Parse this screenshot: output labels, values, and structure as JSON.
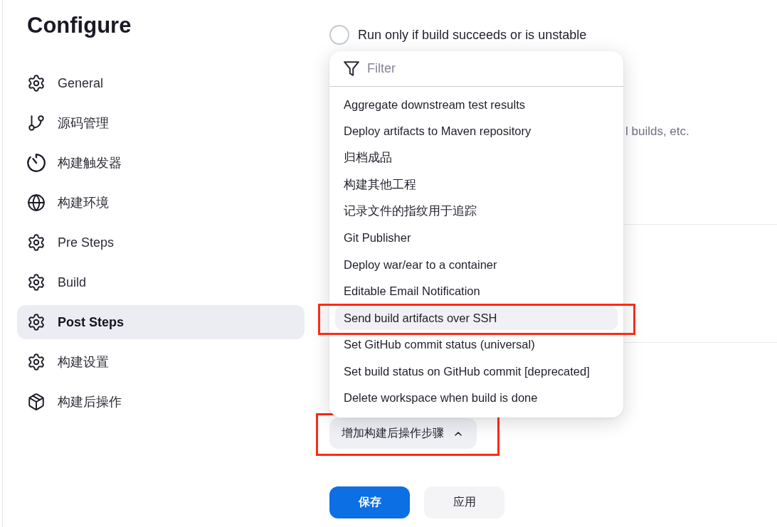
{
  "page": {
    "title": "Configure"
  },
  "sidebar": {
    "items": [
      {
        "label": "General",
        "selected": false
      },
      {
        "label": "源码管理",
        "selected": false
      },
      {
        "label": "构建触发器",
        "selected": false
      },
      {
        "label": "构建环境",
        "selected": false
      },
      {
        "label": "Pre Steps",
        "selected": false
      },
      {
        "label": "Build",
        "selected": false
      },
      {
        "label": "Post Steps",
        "selected": true
      },
      {
        "label": "构建设置",
        "selected": false
      },
      {
        "label": "构建后操作",
        "selected": false
      }
    ]
  },
  "post_build_condition": {
    "label": "Run only if build succeeds or is unstable",
    "checked": false
  },
  "description_fragment": "l builds, etc.",
  "step_menu": {
    "filter": {
      "placeholder": "Filter"
    },
    "items": [
      {
        "label": "Aggregate downstream test results",
        "selected": false,
        "annotated": false
      },
      {
        "label": "Deploy artifacts to Maven repository",
        "selected": false,
        "annotated": false
      },
      {
        "label": "归档成品",
        "selected": false,
        "annotated": false
      },
      {
        "label": "构建其他工程",
        "selected": false,
        "annotated": false
      },
      {
        "label": "记录文件的指纹用于追踪",
        "selected": false,
        "annotated": false
      },
      {
        "label": "Git Publisher",
        "selected": false,
        "annotated": false
      },
      {
        "label": "Deploy war/ear to a container",
        "selected": false,
        "annotated": false
      },
      {
        "label": "Editable Email Notification",
        "selected": false,
        "annotated": false
      },
      {
        "label": "Send build artifacts over SSH",
        "selected": true,
        "annotated": true
      },
      {
        "label": "Set GitHub commit status (universal)",
        "selected": false,
        "annotated": false
      },
      {
        "label": "Set build status on GitHub commit [deprecated]",
        "selected": false,
        "annotated": false
      },
      {
        "label": "Delete workspace when build is done",
        "selected": false,
        "annotated": false
      }
    ]
  },
  "add_step_button": {
    "label": "增加构建后操作步骤",
    "expanded": true,
    "annotated": true
  },
  "buttons": [
    {
      "label": "保存",
      "kind": "primary"
    },
    {
      "label": "应用",
      "kind": "secondary"
    }
  ]
}
